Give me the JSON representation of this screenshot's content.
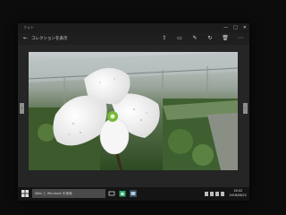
{
  "window": {
    "app_title": "フォト",
    "minimize_label": "—",
    "maximize_label": "□",
    "close_label": "✕"
  },
  "toolbar": {
    "back_label": "←",
    "collection_title": "コレクションを表示",
    "tools": [
      {
        "name": "share-icon",
        "glyph": "⇪"
      },
      {
        "name": "slideshow-icon",
        "glyph": "▭"
      },
      {
        "name": "edit-icon",
        "glyph": "✎"
      },
      {
        "name": "rotate-icon",
        "glyph": "↻"
      },
      {
        "name": "delete-icon",
        "glyph": "🗑"
      },
      {
        "name": "more-icon",
        "glyph": "⋯"
      }
    ]
  },
  "viewer": {
    "prev_label": "‹",
    "next_label": "›"
  },
  "taskbar": {
    "search_placeholder": "Web と Windows を検索",
    "clock_time": "16:02",
    "clock_date": "2016/08/21"
  }
}
